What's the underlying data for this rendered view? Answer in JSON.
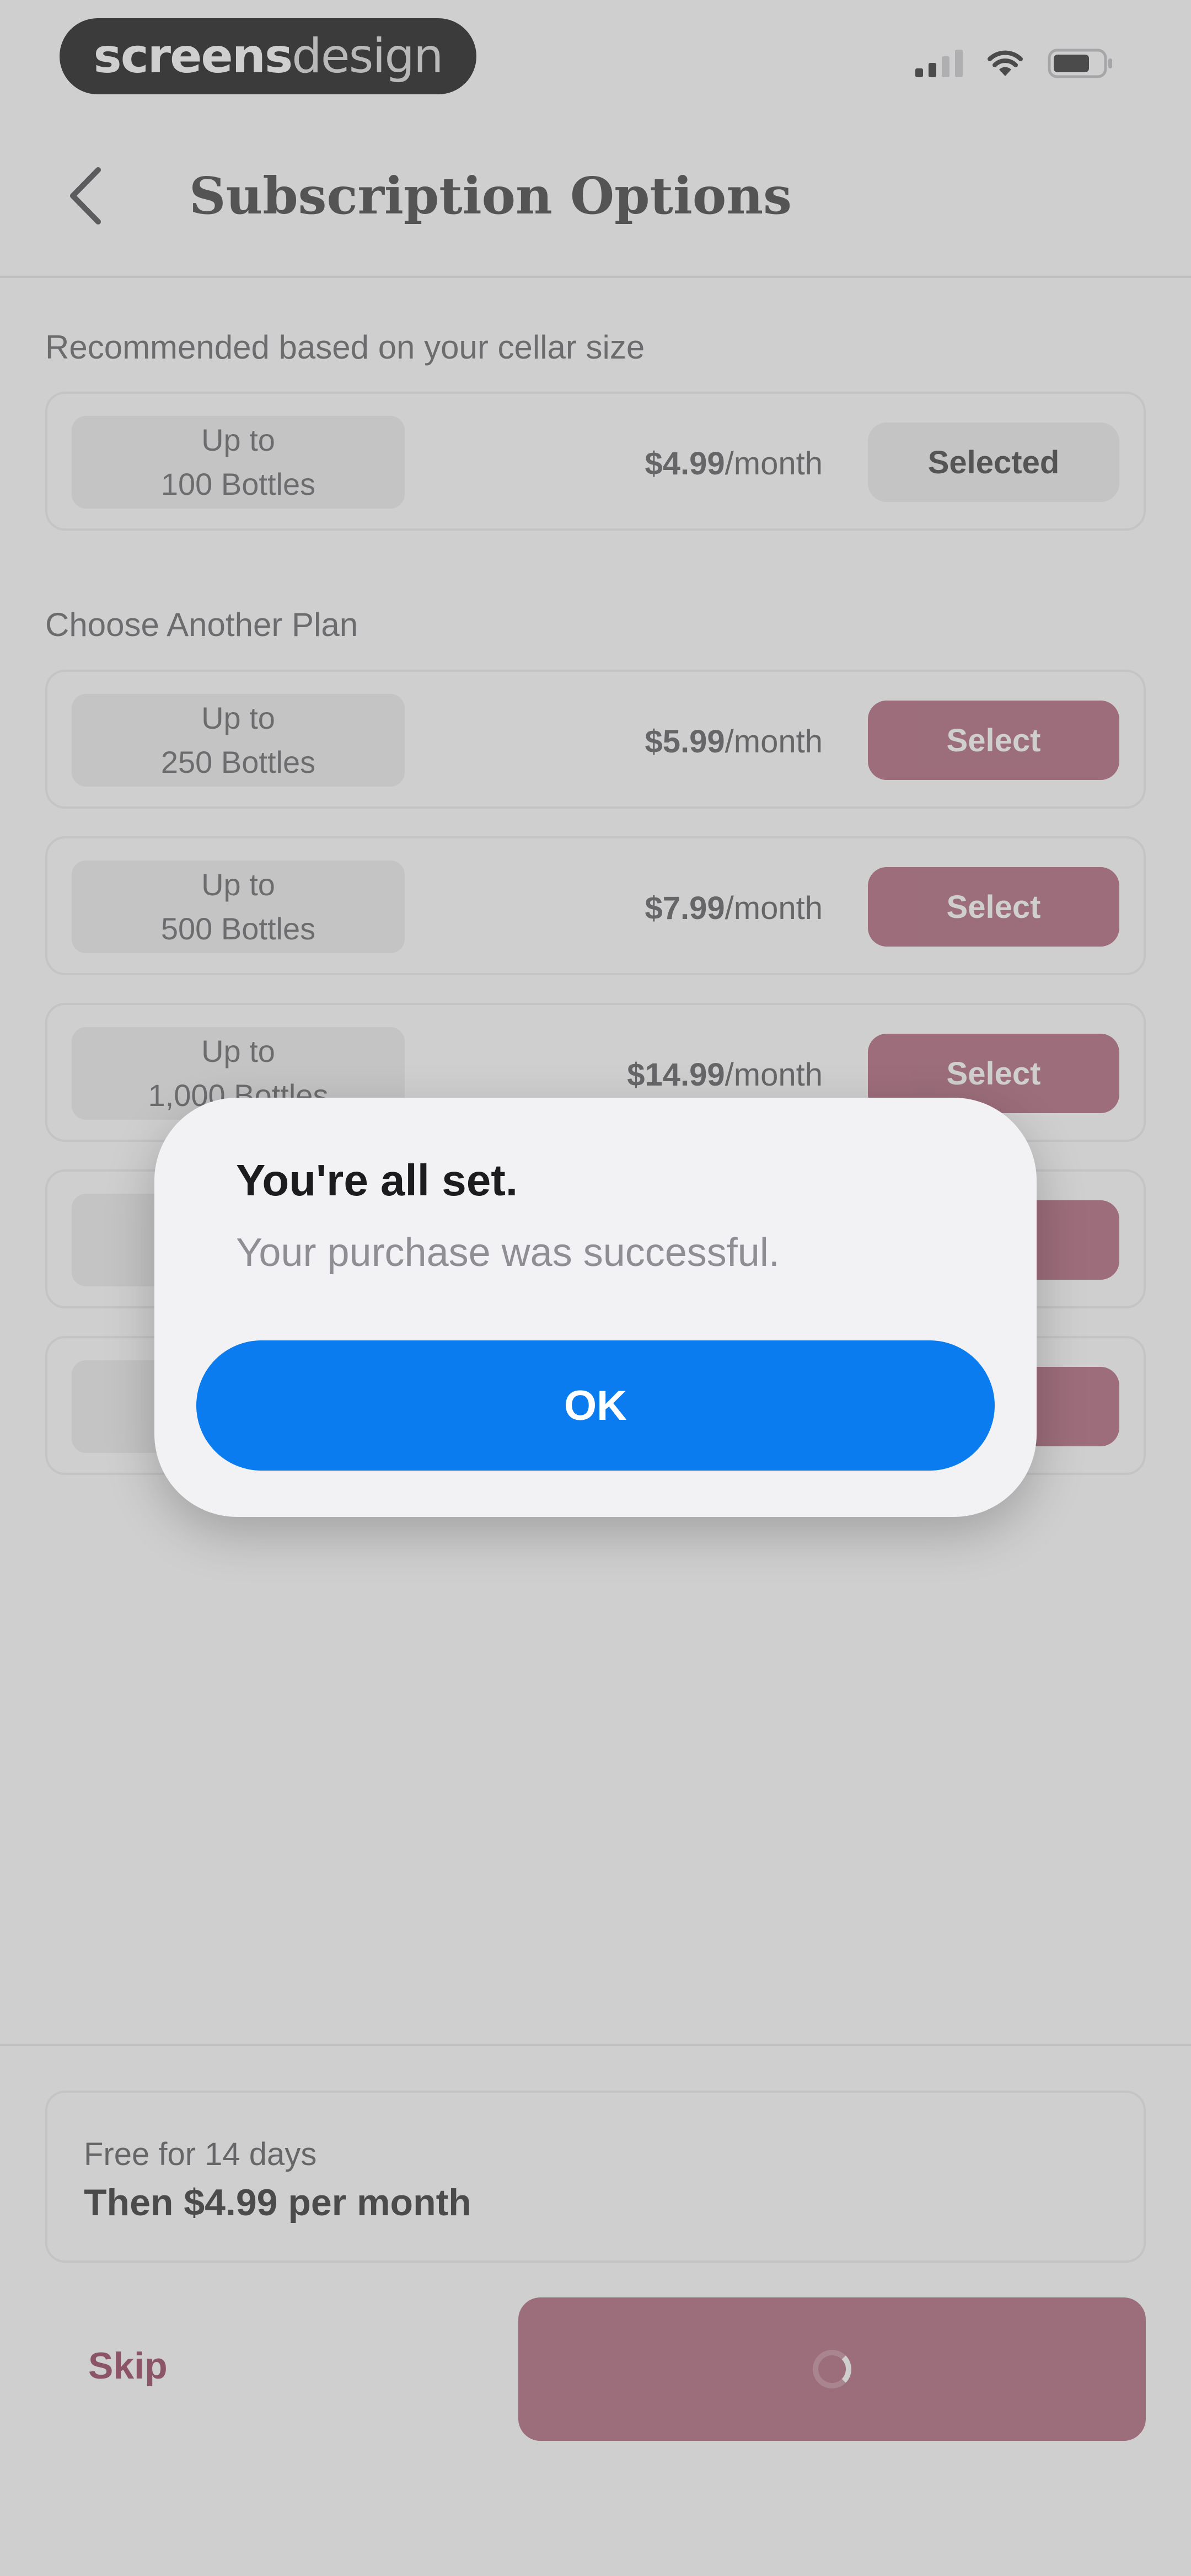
{
  "status_bar": {
    "logo_bold": "screens",
    "logo_light": "design"
  },
  "nav": {
    "title": "Subscription Options"
  },
  "recommended": {
    "label": "Recommended based on your cellar size",
    "plan": {
      "tag_line1": "Up to",
      "tag_line2": "100 Bottles",
      "price": "$4.99",
      "per": "/month",
      "button": "Selected"
    }
  },
  "other_plans": {
    "label": "Choose Another Plan",
    "plans": [
      {
        "tag_line1": "Up to",
        "tag_line2": "250 Bottles",
        "price": "$5.99",
        "per": "/month",
        "button": "Select"
      },
      {
        "tag_line1": "Up to",
        "tag_line2": "500 Bottles",
        "price": "$7.99",
        "per": "/month",
        "button": "Select"
      },
      {
        "tag_line1": "Up to",
        "tag_line2": "1,000 Bottles",
        "price": "$14.99",
        "per": "/month",
        "button": "Select"
      },
      {
        "tag_line1": "",
        "tag_line2": "",
        "price": "",
        "per": "",
        "button": ""
      },
      {
        "tag_line1": "",
        "tag_line2": "",
        "price": "",
        "per": "",
        "button": ""
      }
    ]
  },
  "trial": {
    "line1": "Free for 14 days",
    "line2": "Then $4.99 per month"
  },
  "footer": {
    "skip_label": "Skip"
  },
  "alert": {
    "title": "You're all set.",
    "message": "Your purchase was successful.",
    "ok_label": "OK"
  },
  "colors": {
    "accent": "#9a3a55",
    "alert_button": "#0a7cf0"
  }
}
